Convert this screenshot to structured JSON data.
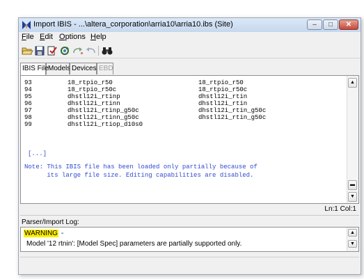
{
  "window": {
    "title": "Import IBIS - ...\\altera_corporation\\arria10\\arria10.ibs (Site)",
    "min_glyph": "–",
    "max_glyph": "□",
    "close_glyph": "✕"
  },
  "menu": {
    "file": {
      "hotkey": "F",
      "rest": "ile"
    },
    "edit": {
      "hotkey": "E",
      "rest": "dit"
    },
    "options": {
      "hotkey": "O",
      "rest": "ptions"
    },
    "help": {
      "hotkey": "H",
      "rest": "elp"
    }
  },
  "toolbar": {
    "icons": [
      "open-folder-icon",
      "save-icon",
      "check-icon",
      "recycle-icon",
      "redo-icon",
      "undo-icon",
      "binoculars-icon"
    ]
  },
  "tabs": [
    {
      "label": "IBIS File",
      "active": true
    },
    {
      "label": "Models",
      "active": false
    },
    {
      "label": "Devices",
      "active": false
    },
    {
      "label": "EBD",
      "active": false,
      "disabled": true
    }
  ],
  "editor": {
    "rows": [
      {
        "num": "93",
        "name": "18_rtpio_r50",
        "model": "18_rtpio_r50"
      },
      {
        "num": "94",
        "name": "18_rtpio_r50c",
        "model": "18_rtpio_r50c"
      },
      {
        "num": "95",
        "name": "dhstl12i_rtinp",
        "model": "dhstl12i_rtin"
      },
      {
        "num": "96",
        "name": "dhstl12i_rtinn",
        "model": "dhstl12i_rtin"
      },
      {
        "num": "97",
        "name": "dhstl12i_rtinp_g50c",
        "model": "dhstl12i_rtin_g50c"
      },
      {
        "num": "98",
        "name": "dhstl12i_rtinn_g50c",
        "model": "dhstl12i_rtin_g50c"
      },
      {
        "num": "99",
        "name": "dhstl12i_rtiop_d10s0",
        "model": ""
      }
    ],
    "ellipsis": "[...]",
    "note_line1": "Note: This IBIS file has been loaded only partially because of",
    "note_line2": "      its large file size. Editing capabilities are disabled."
  },
  "status": {
    "position": "Ln:1 Col:1"
  },
  "parser": {
    "label": "Parser/Import Log:",
    "warning": "WARNING",
    "warning_suffix": "-",
    "message": "Model '12 rtnin': [Model Spec] parameters are partially supported only."
  },
  "colors": {
    "note_text": "#2f4bd0",
    "warning_highlight": "#ffef00"
  }
}
